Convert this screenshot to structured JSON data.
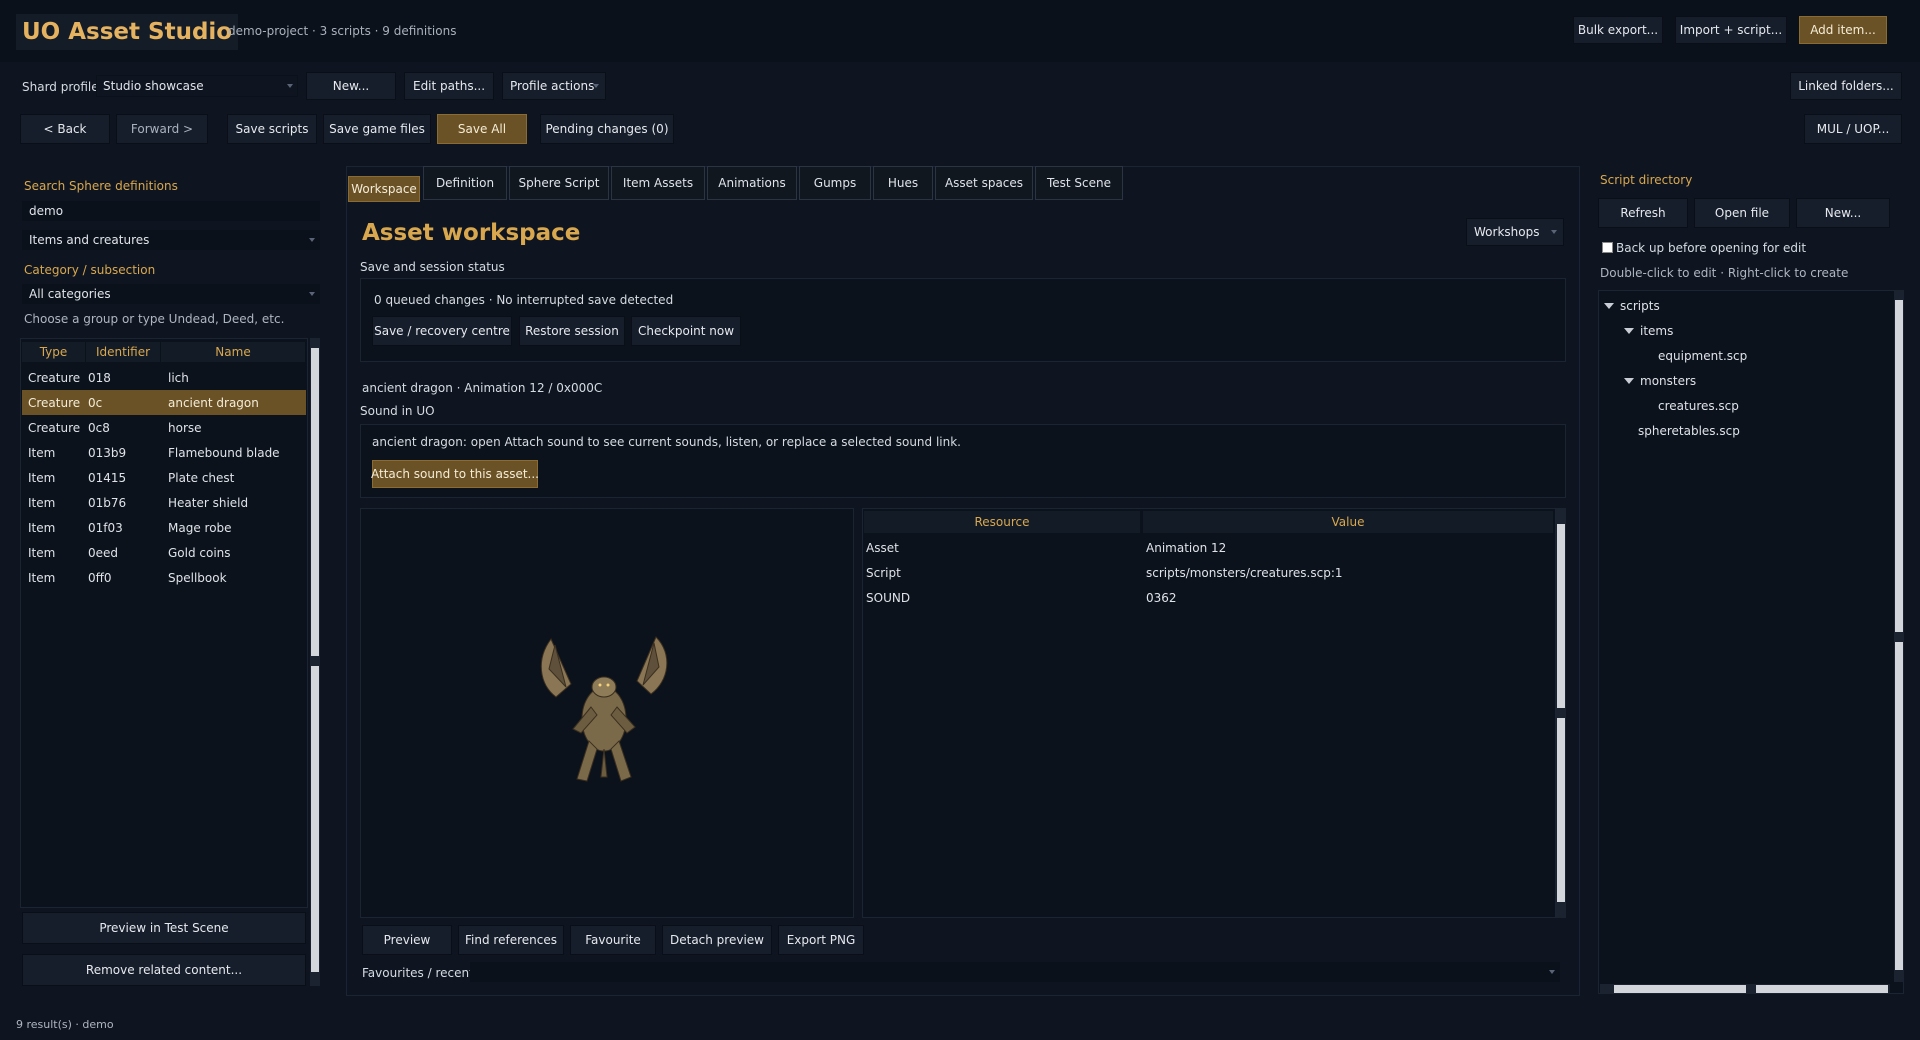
{
  "app": {
    "title": "UO Asset Studio",
    "project_info": "demo-project · 3 scripts · 9 definitions",
    "header_buttons": {
      "bulk_export": "Bulk export...",
      "import_script": "Import + script...",
      "add_item": "Add item..."
    }
  },
  "profile_bar": {
    "label": "Shard profile",
    "selected": "Studio showcase",
    "new": "New...",
    "edit_paths": "Edit paths...",
    "profile_actions": "Profile actions",
    "linked_folders": "Linked folders..."
  },
  "toolbar": {
    "back": "< Back",
    "forward": "Forward >",
    "save_scripts": "Save scripts",
    "save_game_files": "Save game files",
    "save_all": "Save All",
    "pending": "Pending changes (0)",
    "mul_uop": "MUL / UOP..."
  },
  "left": {
    "search_label": "Search Sphere definitions",
    "search_value": "demo",
    "filter_value": "Items and creatures",
    "category_label": "Category / subsection",
    "category_value": "All categories",
    "category_hint": "Choose a group or type Undead, Deed, etc.",
    "columns": [
      "Type",
      "Identifier",
      "Name"
    ],
    "rows": [
      {
        "type": "Creature",
        "id": "018",
        "name": "lich"
      },
      {
        "type": "Creature",
        "id": "0c",
        "name": "ancient dragon"
      },
      {
        "type": "Creature",
        "id": "0c8",
        "name": "horse"
      },
      {
        "type": "Item",
        "id": "013b9",
        "name": "Flamebound blade"
      },
      {
        "type": "Item",
        "id": "01415",
        "name": "Plate chest"
      },
      {
        "type": "Item",
        "id": "01b76",
        "name": "Heater shield"
      },
      {
        "type": "Item",
        "id": "01f03",
        "name": "Mage robe"
      },
      {
        "type": "Item",
        "id": "0eed",
        "name": "Gold coins"
      },
      {
        "type": "Item",
        "id": "0ff0",
        "name": "Spellbook"
      }
    ],
    "preview_test_scene": "Preview in Test Scene",
    "remove_related": "Remove related content..."
  },
  "tabs": [
    "Workspace",
    "Definition",
    "Sphere Script",
    "Item Assets",
    "Animations",
    "Gumps",
    "Hues",
    "Asset spaces",
    "Test Scene"
  ],
  "workspace": {
    "title": "Asset workspace",
    "workshops": "Workshops",
    "session_label": "Save and session status",
    "session_status": "0 queued changes · No interrupted save detected",
    "save_recovery": "Save / recovery centre",
    "restore_session": "Restore session",
    "checkpoint": "Checkpoint now",
    "asset_caption": "ancient dragon · Animation 12 / 0x000C",
    "sound_label": "Sound in UO",
    "sound_text": "ancient dragon: open Attach sound to see current sounds, listen, or replace a selected sound link.",
    "attach_sound": "Attach sound to this asset...",
    "resource_columns": [
      "Resource",
      "Value"
    ],
    "resources": [
      {
        "k": "Asset",
        "v": "Animation 12"
      },
      {
        "k": "Script",
        "v": "scripts/monsters/creatures.scp:1"
      },
      {
        "k": "SOUND",
        "v": "0362"
      }
    ],
    "actions": [
      "Preview",
      "Find references",
      "Favourite",
      "Detach preview",
      "Export PNG"
    ],
    "favourites_label": "Favourites / recent:"
  },
  "script_dir": {
    "title": "Script directory",
    "refresh": "Refresh",
    "open_file": "Open file",
    "new": "New...",
    "backup_label": "Back up before opening for edit",
    "hint": "Double-click to edit · Right-click to create",
    "tree": {
      "root": "scripts",
      "items": "items",
      "equipment": "equipment.scp",
      "monsters": "monsters",
      "creatures": "creatures.scp",
      "spheretables": "spheretables.scp"
    }
  },
  "status_bar": "9 result(s) · demo",
  "colors": {
    "accent": "#d9a84e",
    "gold_button": "#6a5226",
    "background": "#0f1520"
  }
}
